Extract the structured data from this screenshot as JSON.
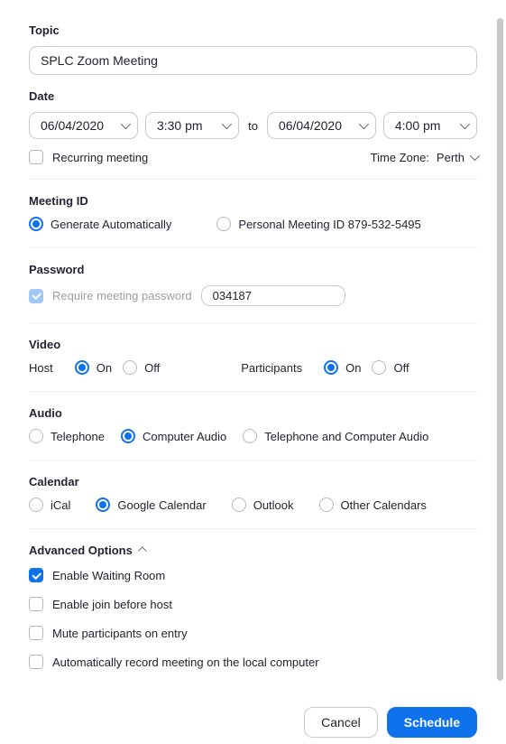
{
  "topic": {
    "label": "Topic",
    "value": "SPLC Zoom Meeting"
  },
  "date": {
    "label": "Date",
    "start_date": "06/04/2020",
    "start_time": "3:30 pm",
    "to": "to",
    "end_date": "06/04/2020",
    "end_time": "4:00 pm",
    "recurring_label": "Recurring meeting",
    "timezone_label": "Time Zone:",
    "timezone_value": "Perth"
  },
  "meeting_id": {
    "label": "Meeting ID",
    "generate_label": "Generate Automatically",
    "personal_label": "Personal Meeting ID 879-532-5495"
  },
  "password": {
    "label": "Password",
    "require_label": "Require meeting password",
    "value": "034187"
  },
  "video": {
    "label": "Video",
    "host_label": "Host",
    "participants_label": "Participants",
    "on": "On",
    "off": "Off"
  },
  "audio": {
    "label": "Audio",
    "telephone": "Telephone",
    "computer": "Computer Audio",
    "both": "Telephone and Computer Audio"
  },
  "calendar": {
    "label": "Calendar",
    "ical": "iCal",
    "google": "Google Calendar",
    "outlook": "Outlook",
    "other": "Other Calendars"
  },
  "advanced": {
    "label": "Advanced Options",
    "waiting_room": "Enable Waiting Room",
    "join_before": "Enable join before host",
    "mute_on_entry": "Mute participants on entry",
    "auto_record": "Automatically record meeting on the local computer"
  },
  "footer": {
    "cancel": "Cancel",
    "schedule": "Schedule"
  }
}
